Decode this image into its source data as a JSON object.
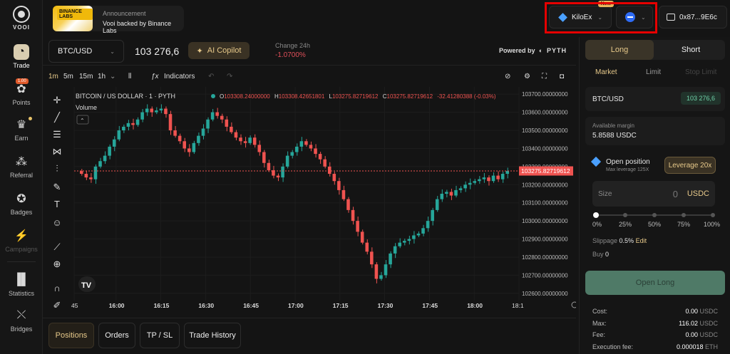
{
  "app": {
    "name": "VOOI"
  },
  "nav": {
    "items": [
      {
        "label": "Trade",
        "icon": "trade-icon"
      },
      {
        "label": "Points",
        "icon": "points-icon",
        "badge": "1.00"
      },
      {
        "label": "Earn",
        "icon": "earn-icon"
      },
      {
        "label": "Referral",
        "icon": "referral-icon"
      },
      {
        "label": "Badges",
        "icon": "badges-icon"
      },
      {
        "label": "Campaigns",
        "icon": "campaigns-icon"
      },
      {
        "label": "Statistics",
        "icon": "statistics-icon"
      },
      {
        "label": "Bridges",
        "icon": "bridges-icon"
      }
    ]
  },
  "announcement": {
    "banner": "BINANCE LABS",
    "title": "Announcement",
    "text": "Vooi backed by Binance Labs"
  },
  "topbar": {
    "exchange": "KiloEx",
    "new_tag": "New",
    "wallet": "0x87...9E6c"
  },
  "pair": {
    "symbol": "BTC/USD",
    "price": "103 276,6",
    "ai_button": "AI Copilot",
    "change_label": "Change 24h",
    "change_value": "-1.0700%",
    "powered_by": "Powered by",
    "oracle": "PYTH"
  },
  "toolbar": {
    "timeframes": [
      "1m",
      "5m",
      "15m",
      "1h"
    ],
    "active_timeframe": "1m",
    "indicators_label": "Indicators"
  },
  "chart_data": {
    "type": "candlestick",
    "title": "BITCOIN / US DOLLAR · 1 · PYTH",
    "ohlc_text": {
      "o_label": "O",
      "o": "103308.24000000",
      "h_label": "H",
      "h": "103308.42651801",
      "l_label": "L",
      "l": "103275.82719612",
      "c_label": "C",
      "c": "103275.82719612",
      "change": "-32.41280388 (-0.03%)"
    },
    "volume_label": "Volume",
    "current_price_label": "103275.82719612",
    "y_ticks": [
      "103700.00000000",
      "103600.00000000",
      "103500.00000000",
      "103400.00000000",
      "103300.00000000",
      "103200.00000000",
      "103100.00000000",
      "103000.00000000",
      "102900.00000000",
      "102800.00000000",
      "102700.00000000",
      "102600.00000000"
    ],
    "x_ticks": [
      "45",
      "16:00",
      "16:15",
      "16:30",
      "16:45",
      "17:00",
      "17:15",
      "17:30",
      "17:45",
      "18:00",
      "18:1"
    ],
    "ylim": [
      102560,
      103740
    ],
    "close_series": [
      103260,
      103240,
      103230,
      103300,
      103330,
      103360,
      103410,
      103450,
      103500,
      103520,
      103540,
      103530,
      103560,
      103600,
      103620,
      103600,
      103610,
      103620,
      103590,
      103500,
      103470,
      103440,
      103400,
      103380,
      103430,
      103470,
      103510,
      103560,
      103600,
      103580,
      103560,
      103520,
      103490,
      103460,
      103440,
      103430,
      103460,
      103420,
      103380,
      103320,
      103280,
      103250,
      103240,
      103300,
      103360,
      103380,
      103410,
      103440,
      103420,
      103400,
      103370,
      103340,
      103300,
      103260,
      103220,
      103170,
      103120,
      103060,
      103000,
      102940,
      102880,
      102830,
      102760,
      102680,
      102700,
      102760,
      102820,
      102860,
      102880,
      102890,
      102900,
      102920,
      102930,
      102960,
      103000,
      103060,
      103120,
      103150,
      103160,
      103140,
      103170,
      103180,
      103200,
      103210,
      103220,
      103230,
      103240,
      103220,
      103250,
      103230,
      103260,
      103276
    ]
  },
  "order": {
    "tabs": [
      "Long",
      "Short"
    ],
    "types": [
      "Market",
      "Limit",
      "Stop Limit"
    ],
    "pair_label": "BTC/USD",
    "pair_price": "103 276,6",
    "margin_label": "Available margin",
    "margin_value": "5.8588 USDC",
    "open_position": "Open position",
    "max_leverage": "Max leverage 125X",
    "leverage_btn": "Leverage 20x",
    "size_placeholder": "Size",
    "size_value": "0",
    "size_unit": "USDC",
    "percents": [
      "0%",
      "25%",
      "50%",
      "75%",
      "100%"
    ],
    "slippage_label": "Slippage",
    "slippage_value": "0.5%",
    "slippage_edit": "Edit",
    "buy_label": "Buy",
    "buy_value": "0",
    "submit": "Open Long",
    "fees": [
      {
        "label": "Cost:",
        "value": "0.00",
        "unit": "USDC"
      },
      {
        "label": "Max:",
        "value": "116.02",
        "unit": "USDC"
      },
      {
        "label": "Fee:",
        "value": "0.00",
        "unit": "USDC"
      },
      {
        "label": "Execution fee:",
        "value": "0.000018",
        "unit": "ETH"
      }
    ]
  },
  "bottom_tabs": [
    "Positions",
    "Orders",
    "TP / SL",
    "Trade History"
  ],
  "colors": {
    "up": "#26a69a",
    "down": "#ef5350",
    "accent": "#e7c98a",
    "highlight_box": "#e60000"
  }
}
